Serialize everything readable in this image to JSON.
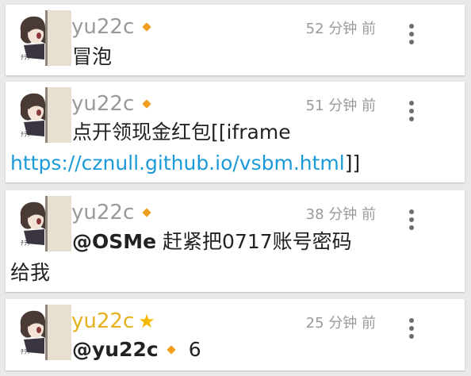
{
  "posts": [
    {
      "username": "yu22c",
      "time": "52 分钟 前",
      "text": "冒泡"
    },
    {
      "username": "yu22c",
      "time": "51 分钟 前",
      "text_prefix": "点开领现金红包[[iframe",
      "link": "https://cznull.github.io/vsbm.html",
      "text_suffix": "]]"
    },
    {
      "username": "yu22c",
      "time": "38 分钟 前",
      "mention": "@OSMe",
      "text_line1": " 赶紧把0717账号密码",
      "text_line2": "给我"
    },
    {
      "username": "yu22c",
      "time": "25 分钟 前",
      "mention": "@yu22c",
      "count": "6"
    }
  ],
  "colors": {
    "username": "#9a9a9a",
    "username_highlight": "#e4b21d",
    "link": "#1a9ad8",
    "badge": "#f0a020",
    "star": "#f5b800"
  },
  "icons": {
    "badge": "diamond-icon",
    "star": "star-icon",
    "menu": "more-vertical-icon"
  }
}
